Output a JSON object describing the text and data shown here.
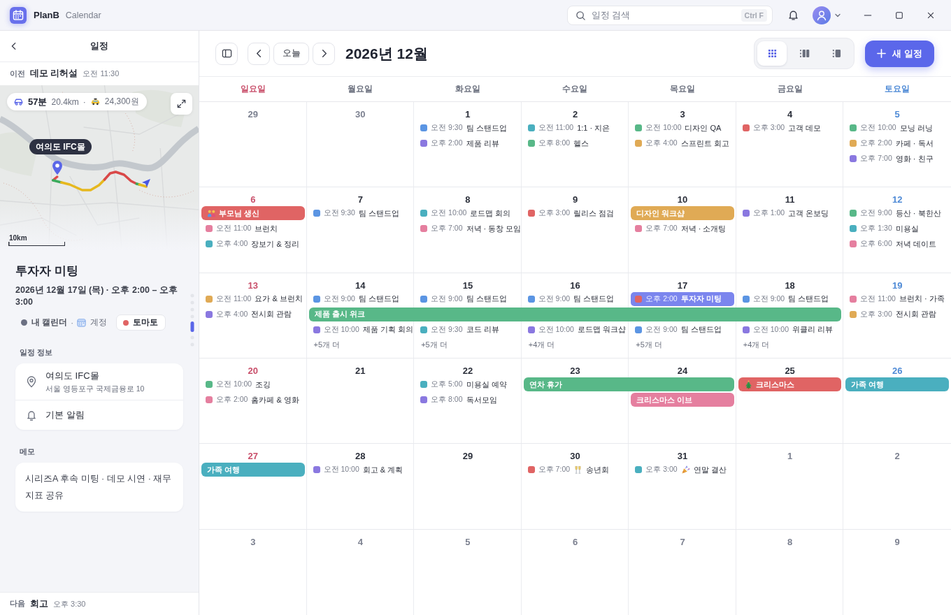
{
  "app": {
    "name": "PlanB",
    "subtitle": "Calendar"
  },
  "search": {
    "placeholder": "일정 검색",
    "shortcut": "Ctrl F"
  },
  "sidebar": {
    "title": "일정",
    "previous": {
      "label": "이전",
      "title": "데모 리허설",
      "time": "오전 11:30"
    },
    "map": {
      "duration": "57분",
      "distance": "20.4km",
      "separator": "·",
      "fare": "24,300원",
      "place": "여의도 IFC몰",
      "scale": "10km"
    },
    "event": {
      "title": "투자자 미팅",
      "when": "2026년 12월 17일 (목) · 오후 2:00 – 오후 3:00",
      "calendar": {
        "name": "내 캘린더",
        "color": "#6b7083"
      },
      "separator": "·",
      "account": "계정",
      "tag": {
        "name": "토마토",
        "color": "#e06464"
      }
    },
    "info": {
      "heading": "일정 정보",
      "place": "여의도 IFC몰",
      "address": "서울 영등포구 국제금융로 10",
      "reminder": "기본 알림"
    },
    "memo": {
      "heading": "메모",
      "text": "시리즈A 후속 미팅 · 데모 시연 · 재무 지표 공유"
    },
    "next": {
      "label": "다음",
      "title": "회고",
      "time": "오후 3:30"
    }
  },
  "toolbar": {
    "today": "오늘",
    "title": "2026년 12월",
    "views": [
      {
        "kind": "grid",
        "selected": true
      },
      {
        "kind": "columns",
        "selected": false
      },
      {
        "kind": "list",
        "selected": false
      }
    ],
    "new_event": "새 일정"
  },
  "calendar": {
    "weekdays": [
      {
        "label": "일요일",
        "kind": "sunday"
      },
      {
        "label": "월요일",
        "kind": "weekday"
      },
      {
        "label": "화요일",
        "kind": "weekday"
      },
      {
        "label": "수요일",
        "kind": "weekday"
      },
      {
        "label": "목요일",
        "kind": "weekday"
      },
      {
        "label": "금요일",
        "kind": "weekday"
      },
      {
        "label": "토요일",
        "kind": "saturday"
      }
    ],
    "weeks": [
      {
        "days": [
          {
            "date": "29",
            "outside": true
          },
          {
            "date": "30",
            "outside": true
          },
          {
            "date": "1",
            "outside": false,
            "items": [
              {
                "kind": "timed",
                "time": "오전 9:30",
                "title": "팀 스탠드업",
                "color": "#5b95e3",
                "selected": false
              },
              {
                "kind": "timed",
                "time": "오후 2:00",
                "title": "제품 리뷰",
                "color": "#8a78e0",
                "selected": false
              }
            ]
          },
          {
            "date": "2",
            "outside": false,
            "items": [
              {
                "kind": "timed",
                "time": "오전 11:00",
                "title": "1:1 · 지은",
                "color": "#4aafbf",
                "selected": false
              },
              {
                "kind": "timed",
                "time": "오후 8:00",
                "title": "헬스",
                "color": "#58b888",
                "selected": false
              }
            ]
          },
          {
            "date": "3",
            "outside": false,
            "items": [
              {
                "kind": "timed",
                "time": "오전 10:00",
                "title": "디자인 QA",
                "color": "#58b888",
                "selected": false
              },
              {
                "kind": "timed",
                "time": "오후 4:00",
                "title": "스프린트 회고",
                "color": "#e0aa55",
                "selected": false
              }
            ]
          },
          {
            "date": "4",
            "outside": false,
            "items": [
              {
                "kind": "timed",
                "time": "오후 3:00",
                "title": "고객 데모",
                "color": "#e06464",
                "selected": false
              }
            ]
          },
          {
            "date": "5",
            "outside": false,
            "items": [
              {
                "kind": "timed",
                "time": "오전 10:00",
                "title": "모닝 러닝",
                "color": "#58b888",
                "selected": false
              },
              {
                "kind": "timed",
                "time": "오후 2:00",
                "title": "카페 · 독서",
                "color": "#e0aa55",
                "selected": false
              },
              {
                "kind": "timed",
                "time": "오후 7:00",
                "title": "영화 · 친구",
                "color": "#8a78e0",
                "selected": false
              }
            ]
          }
        ]
      },
      {
        "days": [
          {
            "date": "6",
            "outside": false,
            "items": [
              {
                "kind": "birthday",
                "title": "부모님 생신",
                "color": "#e06464",
                "selected": false
              },
              {
                "kind": "timed",
                "time": "오전 11:00",
                "title": "브런치",
                "color": "#e57f9f",
                "selected": false
              },
              {
                "kind": "timed",
                "time": "오후 4:00",
                "title": "장보기 & 정리",
                "color": "#4aafbf",
                "selected": false
              }
            ]
          },
          {
            "date": "7",
            "outside": false,
            "items": [
              {
                "kind": "timed",
                "time": "오전 9:30",
                "title": "팀 스탠드업",
                "color": "#5b95e3",
                "selected": false
              }
            ]
          },
          {
            "date": "8",
            "outside": false,
            "items": [
              {
                "kind": "timed",
                "time": "오전 10:00",
                "title": "로드맵 회의",
                "color": "#4aafbf",
                "selected": false
              },
              {
                "kind": "timed",
                "time": "오후 7:00",
                "title": "저녁 · 동창 모임",
                "color": "#e57f9f",
                "selected": false
              }
            ]
          },
          {
            "date": "9",
            "outside": false,
            "items": [
              {
                "kind": "timed",
                "time": "오후 3:00",
                "title": "릴리스 점검",
                "color": "#e06464",
                "selected": false
              }
            ]
          },
          {
            "date": "10",
            "outside": false,
            "items": [
              {
                "kind": "allday",
                "title": "디자인 워크샵",
                "color": "#e0aa55",
                "selected": false
              },
              {
                "kind": "timed",
                "time": "오후 7:00",
                "title": "저녁 · 소개팅",
                "color": "#e57f9f",
                "selected": false
              }
            ]
          },
          {
            "date": "11",
            "outside": false,
            "items": [
              {
                "kind": "timed",
                "time": "오후 1:00",
                "title": "고객 온보딩",
                "color": "#8a78e0",
                "selected": false
              }
            ]
          },
          {
            "date": "12",
            "outside": false,
            "items": [
              {
                "kind": "timed",
                "time": "오전 9:00",
                "title": "등산 · 북한산",
                "color": "#58b888",
                "selected": false
              },
              {
                "kind": "timed",
                "time": "오후 1:30",
                "title": "미용실",
                "color": "#4aafbf",
                "selected": false
              },
              {
                "kind": "timed",
                "time": "오후 6:00",
                "title": "저녁 데이트",
                "color": "#e57f9f",
                "selected": false
              }
            ]
          }
        ]
      },
      {
        "days": [
          {
            "date": "13",
            "outside": false,
            "items": [
              {
                "kind": "timed",
                "time": "오전 11:00",
                "title": "요가 & 브런치",
                "color": "#e0aa55",
                "selected": false
              },
              {
                "kind": "timed",
                "time": "오후 4:00",
                "title": "전시회 관람",
                "color": "#8a78e0",
                "selected": false
              }
            ]
          },
          {
            "date": "14",
            "outside": false,
            "items": [
              {
                "kind": "timed",
                "time": "오전 9:00",
                "title": "팀 스탠드업",
                "color": "#5b95e3",
                "selected": false
              },
              {
                "kind": "allday",
                "title": "제품 출시 위크",
                "color": "#58b888",
                "selected": false
              },
              {
                "kind": "timed",
                "time": "오전 10:00",
                "title": "제품 기획 회의",
                "color": "#8a78e0",
                "selected": false
              },
              {
                "kind": "more",
                "label": "+5개 더"
              }
            ]
          },
          {
            "date": "15",
            "outside": false,
            "items": [
              {
                "kind": "timed",
                "time": "오전 9:00",
                "title": "팀 스탠드업",
                "color": "#5b95e3",
                "selected": false
              },
              {
                "kind": "continued"
              },
              {
                "kind": "timed",
                "time": "오전 9:30",
                "title": "코드 리뷰",
                "color": "#4aafbf",
                "selected": false
              },
              {
                "kind": "more",
                "label": "+5개 더"
              }
            ]
          },
          {
            "date": "16",
            "outside": false,
            "items": [
              {
                "kind": "timed",
                "time": "오전 9:00",
                "title": "팀 스탠드업",
                "color": "#5b95e3",
                "selected": false
              },
              {
                "kind": "continued"
              },
              {
                "kind": "timed",
                "time": "오전 10:00",
                "title": "로드맵 워크샵",
                "color": "#8a78e0",
                "selected": false
              },
              {
                "kind": "more",
                "label": "+4개 더"
              }
            ]
          },
          {
            "date": "17",
            "outside": false,
            "items": [
              {
                "kind": "timed",
                "time": "오후 2:00",
                "title": "투자자 미팅",
                "color": "#e06464",
                "selected": true
              },
              {
                "kind": "continued"
              },
              {
                "kind": "timed",
                "time": "오전 9:00",
                "title": "팀 스탠드업",
                "color": "#5b95e3",
                "selected": false
              },
              {
                "kind": "more",
                "label": "+5개 더"
              }
            ]
          },
          {
            "date": "18",
            "outside": false,
            "items": [
              {
                "kind": "timed",
                "time": "오전 9:00",
                "title": "팀 스탠드업",
                "color": "#5b95e3",
                "selected": false
              },
              {
                "kind": "continued"
              },
              {
                "kind": "timed",
                "time": "오전 10:00",
                "title": "위클리 리뷰",
                "color": "#8a78e0",
                "selected": false
              },
              {
                "kind": "more",
                "label": "+4개 더"
              }
            ]
          },
          {
            "date": "19",
            "outside": false,
            "items": [
              {
                "kind": "timed",
                "time": "오전 11:00",
                "title": "브런치 · 가족",
                "color": "#e57f9f",
                "selected": false
              },
              {
                "kind": "timed",
                "time": "오후 3:00",
                "title": "전시회 관람",
                "color": "#e0aa55",
                "selected": false
              }
            ]
          }
        ]
      },
      {
        "days": [
          {
            "date": "20",
            "outside": false,
            "items": [
              {
                "kind": "timed",
                "time": "오전 10:00",
                "title": "조깅",
                "color": "#58b888",
                "selected": false
              },
              {
                "kind": "timed",
                "time": "오후 2:00",
                "title": "홈카페 & 영화",
                "color": "#e57f9f",
                "selected": false
              }
            ]
          },
          {
            "date": "21",
            "outside": false
          },
          {
            "date": "22",
            "outside": false,
            "items": [
              {
                "kind": "timed",
                "time": "오후 5:00",
                "title": "미용실 예약",
                "color": "#4aafbf",
                "selected": false
              },
              {
                "kind": "timed",
                "time": "오후 8:00",
                "title": "독서모임",
                "color": "#8a78e0",
                "selected": false
              }
            ]
          },
          {
            "date": "23",
            "outside": false,
            "items": [
              {
                "kind": "allday",
                "title": "연차 휴가",
                "color": "#58b888",
                "selected": false
              }
            ]
          },
          {
            "date": "24",
            "outside": false,
            "items": [
              {
                "kind": "continued"
              },
              {
                "kind": "allday",
                "title": "크리스마스 이브",
                "color": "#e57f9f",
                "selected": false
              }
            ]
          },
          {
            "date": "25",
            "outside": false,
            "items": [
              {
                "kind": "holiday",
                "title": "크리스마스",
                "color": "#e06464",
                "selected": false
              }
            ]
          },
          {
            "date": "26",
            "outside": false,
            "items": [
              {
                "kind": "allday",
                "title": "가족 여행",
                "color": "#4aafbf",
                "selected": false
              }
            ]
          }
        ]
      },
      {
        "days": [
          {
            "date": "27",
            "outside": false,
            "items": [
              {
                "kind": "allday",
                "title": "가족 여행",
                "color": "#4aafbf",
                "selected": false
              }
            ]
          },
          {
            "date": "28",
            "outside": false,
            "items": [
              {
                "kind": "timed",
                "time": "오전 10:00",
                "title": "회고 & 계획",
                "color": "#8a78e0",
                "selected": false
              }
            ]
          },
          {
            "date": "29",
            "outside": false
          },
          {
            "date": "30",
            "outside": false,
            "items": [
              {
                "kind": "toast",
                "time": "오후 7:00",
                "title": "송년회",
                "color": "#e06464",
                "selected": false
              }
            ]
          },
          {
            "date": "31",
            "outside": false,
            "items": [
              {
                "kind": "celebration",
                "time": "오후 3:00",
                "title": "연말 결산",
                "color": "#4aafbf",
                "selected": false
              }
            ]
          },
          {
            "date": "1",
            "outside": true
          },
          {
            "date": "2",
            "outside": true
          }
        ]
      },
      {
        "days": [
          {
            "date": "3",
            "outside": true
          },
          {
            "date": "4",
            "outside": true
          },
          {
            "date": "5",
            "outside": true
          },
          {
            "date": "6",
            "outside": true
          },
          {
            "date": "7",
            "outside": true
          },
          {
            "date": "8",
            "outside": true
          },
          {
            "date": "9",
            "outside": true
          }
        ]
      }
    ]
  }
}
